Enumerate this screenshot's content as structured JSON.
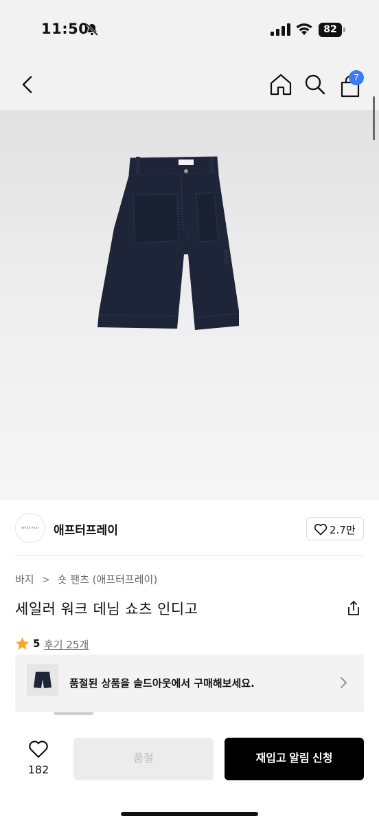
{
  "status_bar": {
    "time": "11:50",
    "battery": "82"
  },
  "header": {
    "cart_count": "7"
  },
  "brand": {
    "logo_text": "AFTER PRAY",
    "name": "애프터프레이",
    "like_count": "2.7만"
  },
  "product": {
    "breadcrumb": [
      "바지",
      "숏 팬츠 (애프터프레이)"
    ],
    "breadcrumb_separator": ">",
    "title": "세일러 워크 데님 쇼츠 인디고",
    "rating": "5",
    "review_link": "후기 25개",
    "rating_color": "#f5a623"
  },
  "soldout_banner": {
    "text": "품절된 상품을 솔드아웃에서 구매해보세요."
  },
  "bottom_bar": {
    "wish_count": "182",
    "soldout_label": "품절",
    "restock_label": "재입고 알림 신청"
  },
  "colors": {
    "accent_badge": "#3b7cf5",
    "primary_button": "#000000",
    "denim": "#1e2538"
  },
  "icons": [
    "bell-slash-icon",
    "signal-icon",
    "wifi-icon",
    "back-arrow-icon",
    "home-icon",
    "search-icon",
    "shopping-bag-icon",
    "heart-icon",
    "share-icon",
    "star-icon",
    "chevron-right-icon"
  ]
}
